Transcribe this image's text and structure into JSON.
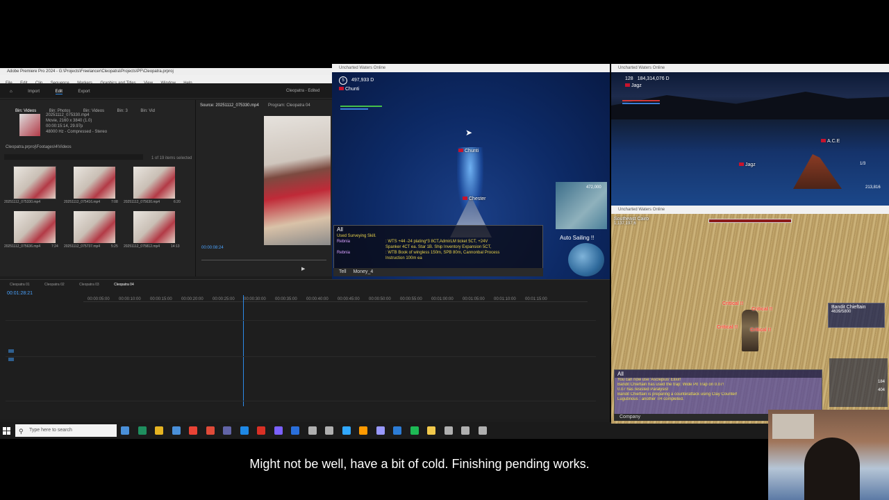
{
  "premiere": {
    "title": "Adobe Premiere Pro 2024 - G:\\Projects\\Freelancer\\Cleopatra\\Projects\\PF\\Cleopatra.prproj",
    "menu": [
      "File",
      "Edit",
      "Clip",
      "Sequence",
      "Markers",
      "Graphics and Titles",
      "View",
      "Window",
      "Help"
    ],
    "header_tabs": [
      "Import",
      "Edit",
      "Export"
    ],
    "project_name": "Cleopatra - Edited",
    "bin_tabs": [
      "Bin: Videos",
      "Bin: Photos",
      "Bin: Videos",
      "Bin: 3",
      "Bin: Vid"
    ],
    "bin_path": "Cleopatra.prproj\\Footages\\4\\Videos",
    "items_selected": "1 of 19 items selected",
    "clip_info": [
      "20251112_075330.mp4",
      "Movie, 2160 x 3840 (1.0)",
      "00:00:15:14, 29.97p",
      "48000 Hz - Compressed - Stereo"
    ],
    "thumbs": [
      {
        "name": "20251112_075330.mp4",
        "dur": "15:14"
      },
      {
        "name": "20251112_075416.mp4",
        "dur": "7:08"
      },
      {
        "name": "20251112_075630.mp4",
        "dur": "6:20"
      },
      {
        "name": "20251112_075636.mp4",
        "dur": "7:24"
      },
      {
        "name": "20251112_075737.mp4",
        "dur": "5:25"
      },
      {
        "name": "20251112_075812.mp4",
        "dur": "14:13"
      }
    ],
    "source_tab": "Source: 20251112_075330.mp4",
    "program_tab": "Program: Cleopatra 04",
    "source_timecode": "00:00:08:24",
    "sequence_tabs": [
      "Cleopatra 01",
      "Cleopatra 02",
      "Cleopatra 03",
      "Cleopatra 04"
    ],
    "timeline_timecode": "00:01:28:21",
    "ruler_ticks": [
      "00:00:05:00",
      "00:00:10:00",
      "00:00:15:00",
      "00:00:20:00",
      "00:00:25:00",
      "00:00:30:00",
      "00:00:35:00",
      "00:00:40:00",
      "00:00:45:00",
      "00:00:50:00",
      "00:00:55:00",
      "00:01:00:00",
      "00:01:05:00",
      "00:01:10:00",
      "00:01:15:00"
    ]
  },
  "taskbar": {
    "search_placeholder": "Type here to search",
    "icon_colors": [
      "#4a90d9",
      "#1f8f5f",
      "#e6b422",
      "#4a90d9",
      "#ea4335",
      "#e04b39",
      "#6264a7",
      "#1e88e5",
      "#d93025",
      "#7b61ff",
      "#2a6fdb",
      "#b0b0b0",
      "#b0b0b0",
      "#31a8ff",
      "#ff9a00",
      "#9999ff",
      "#2c7cd6",
      "#1db954",
      "#f2c94c",
      "#b0b0b0",
      "#b0b0b0",
      "#b0b0b0"
    ]
  },
  "game1": {
    "title": "Uncharted Waters Online",
    "level": "5",
    "ducats": "497,933 D",
    "player": "Chunti",
    "name_tag_top": "Chunti",
    "name_tag_bottom": "Chester",
    "chat_tab": "All",
    "chat_lines": [
      {
        "who": "",
        "msg": "Used Surveying Skill."
      },
      {
        "who": "Rebnia",
        "msg": ": WTS +44 -24 plating*3 8CT,AdmirLM ticket 5CT, +24V"
      },
      {
        "who": "",
        "msg": "Spanker 4CT ea. Star 1B. Ship Inventory Expansion 5CT,"
      },
      {
        "who": "Rebnia",
        "msg": ": WTB Book of wingless 150m, SPB 80m, Cannonbal Process"
      },
      {
        "who": "",
        "msg": "Instruction 100m ea"
      }
    ],
    "tell_label": "Tell",
    "money_label": "Money_4",
    "minimap_label": "472,000",
    "auto_sailing": "Auto Sailing !!"
  },
  "game2": {
    "title": "Uncharted Waters Online",
    "level": "128",
    "ducats": "184,314,076 D",
    "player": "Jagz",
    "name_tag": "Jagz",
    "guild_tag": "A.C.E",
    "page_label": "1/3",
    "coords": "213,816"
  },
  "game3": {
    "title": "Uncharted Waters Online",
    "location": "Southeast Cairo",
    "coords": "1,137,197,6",
    "target_name": "Bandit Chieftain",
    "target_hp": "4639/5800",
    "criticals": [
      "Critical !!",
      "Critical !!",
      "Critical !!",
      "Critical !!"
    ],
    "chat_tab": "All",
    "chat_lines": [
      "You can now use 'Asclepius' Elixir!",
      "Bandit Chieftain has used the trap: Wide Pit Trap on 0.07!",
      "0.07 has resisted Paralysis!",
      "Bandit Chieftain is preparing a counterattack using Clay Counter!",
      "Lugubrious        : another TH completed."
    ],
    "company_label": "Company",
    "skill_counts": [
      "184",
      "404"
    ]
  },
  "subtitle": "Might not be well, have a bit of cold. Finishing pending works."
}
